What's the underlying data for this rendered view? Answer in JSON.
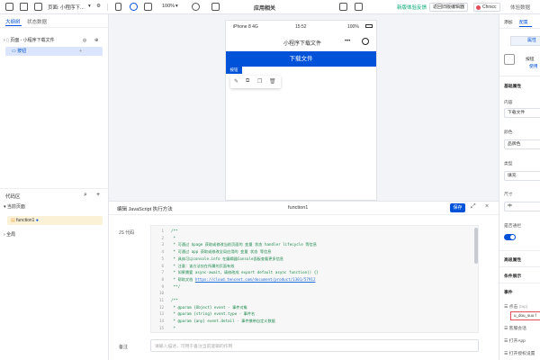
{
  "topbar": {
    "page_label": "页面: 小程序下...",
    "zoom": "100%",
    "app_title": "应用相关",
    "new_version": "新版体验反馈",
    "back_old": "返回旧版编辑器",
    "user": "Chrscc",
    "env": "体验数据"
  },
  "left": {
    "tabs": [
      "大纲树",
      "状态数据"
    ],
    "tree": {
      "page": "页面 - 小程序下载文件",
      "button": "按钮"
    },
    "code_section": {
      "title": "代码区",
      "current_page": "当前页面",
      "function_item": "function1",
      "global": "全局"
    }
  },
  "phone": {
    "carrier": "iPhone 8  4G",
    "time": "15:52",
    "battery": "100%",
    "nav_title": "小程序下载文件",
    "nav_more": "•••",
    "button_tag": "按钮",
    "button_label": "下载文件"
  },
  "code_panel": {
    "title": "编辑 JavaScript 执行方法",
    "func_name": "function1",
    "save": "保存",
    "js_label": "JS 代码",
    "note_label": "备注",
    "note_placeholder": "请输入描述，可用于备注当前逻辑的作用",
    "lines": [
      {
        "n": "1",
        "text": "/**",
        "kind": "cm"
      },
      {
        "n": "2",
        "text": " *",
        "kind": "cm"
      },
      {
        "n": "3",
        "text": " * 可通过 $page 获取或修改当前页面的 变量 状态 handler lifecycle 等信息",
        "kind": "cm"
      },
      {
        "n": "4",
        "text": " * 可通过 app 获取或修改全局应用的 变量 状态 等信息",
        "kind": "cm"
      },
      {
        "n": "5",
        "text": " * 具体可以console.info 在编辑器Console面板查看更多信息",
        "kind": "cm"
      },
      {
        "n": "6",
        "text": " * 注意：该方法仅在所属的页面有效",
        "kind": "cm"
      },
      {
        "n": "7",
        "text": " * 如果需要 async-await，请修改成 export default async function() {}",
        "kind": "cm"
      },
      {
        "n": "8",
        "text": " * 帮助文档 ",
        "link": "https://cloud.tencent.com/document/product/1301/57912",
        "kind": "cm"
      },
      {
        "n": "9",
        "text": " **/",
        "kind": "cm"
      },
      {
        "n": "10",
        "text": "",
        "kind": "cm"
      },
      {
        "n": "11",
        "text": "/**",
        "kind": "cm"
      },
      {
        "n": "12",
        "text": " * @param {Object} event - 事件对象",
        "kind": "cm"
      },
      {
        "n": "13",
        "text": " * @param {string} event.type - 事件名",
        "kind": "cm"
      },
      {
        "n": "14",
        "text": " * @param {any} event.detail - 事件携带自定义数据",
        "kind": "cm"
      },
      {
        "n": "15",
        "text": " *",
        "kind": "cm"
      }
    ]
  },
  "right": {
    "tabs": [
      "添加",
      "配置"
    ],
    "props_btn": "属性",
    "comp_name": "按钮",
    "comp_link": "使用",
    "basic_title": "基础属性",
    "content_label": "内容",
    "content_value": "下载文件",
    "color_label": "颜色",
    "color_value": "品牌色",
    "type_label": "类型",
    "type_value": "填充",
    "size_label": "尺寸",
    "size_value": "中",
    "visible_label": "是否通栏",
    "advanced": "高级属性",
    "condition": "条件展示",
    "events": "事件",
    "click": "点击",
    "click_tag": "(tap)",
    "action": "u_dou_suo f",
    "customer": "客服会话",
    "open_app": "打开App",
    "open_settings": "打开授权设置"
  },
  "colors": {
    "brand": "#0052d9",
    "green": "#00a870"
  }
}
